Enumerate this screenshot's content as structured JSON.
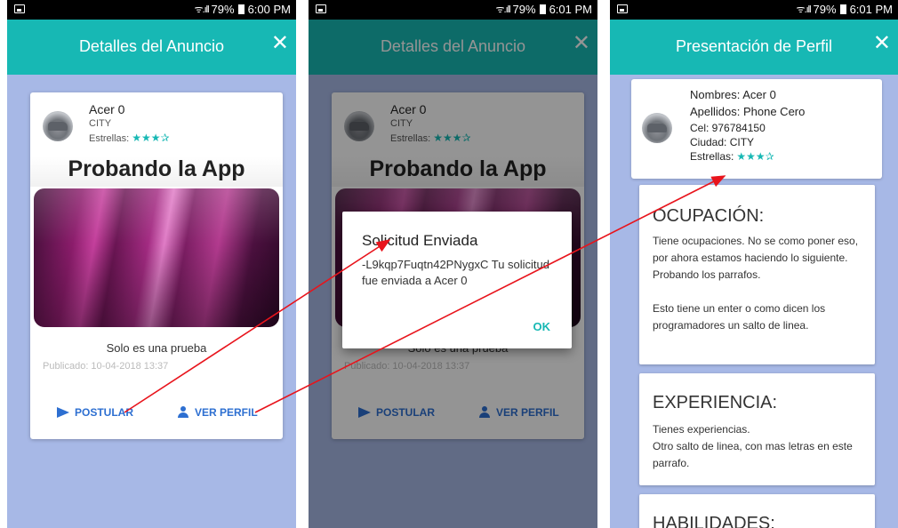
{
  "screen1": {
    "status": {
      "signal": "ᯤ.ıll",
      "battery": "79%",
      "time": "6:00 PM"
    },
    "appbar": {
      "title": "Detalles del Anuncio",
      "close": "✕"
    },
    "ad": {
      "user_name": "Acer 0",
      "city": "CITY",
      "stars_label": "Estrellas:",
      "stars": "★★★✰",
      "title": "Probando la App",
      "description": "Solo es una prueba",
      "published": "Publicado: 10-04-2018 13:37",
      "postular_label": "POSTULAR",
      "ver_perfil_label": "VER PERFIL"
    }
  },
  "screen2": {
    "status": {
      "signal": "ᯤ.ıll",
      "battery": "79%",
      "time": "6:01 PM"
    },
    "appbar": {
      "title": "Detalles del Anuncio",
      "close": "✕"
    },
    "ad": {
      "user_name": "Acer 0",
      "city": "CITY",
      "stars_label": "Estrellas:",
      "stars": "★★★✰",
      "title": "Probando la App",
      "description": "Solo es una prueba",
      "published": "Publicado: 10-04-2018 13:37",
      "postular_label": "POSTULAR",
      "ver_perfil_label": "VER PERFIL"
    },
    "dialog": {
      "title": "Solicitud Enviada",
      "body": "-L9kqp7Fuqtn42PNygxC Tu solicitud fue enviada a Acer 0",
      "ok": "OK"
    }
  },
  "screen3": {
    "status": {
      "signal": "ᯤ.ıll",
      "battery": "79%",
      "time": "6:01 PM"
    },
    "appbar": {
      "title": "Presentación de Perfil",
      "close": "✕"
    },
    "profile": {
      "nombres": "Nombres: Acer 0",
      "apellidos": "Apellidos: Phone Cero",
      "cel": "Cel: 976784150",
      "ciudad": "Ciudad: CITY",
      "stars_label": "Estrellas:",
      "stars": "★★★✰"
    },
    "sections": [
      {
        "title": "OCUPACIÓN:",
        "body": "Tiene ocupaciones. No se como poner eso, por ahora estamos haciendo lo siguiente.\nProbando los parrafos.\n\nEsto tiene un enter o como dicen los programadores un salto de linea."
      },
      {
        "title": "EXPERIENCIA:",
        "body": "Tienes experiencias.\nOtro salto de linea, con mas letras en este parrafo."
      },
      {
        "title": "HABILIDADES:"
      }
    ]
  },
  "colors": {
    "accent": "#17b8b4",
    "action": "#2d6fd1",
    "background": "#a7b8e6",
    "arrow": "#e8141c"
  }
}
